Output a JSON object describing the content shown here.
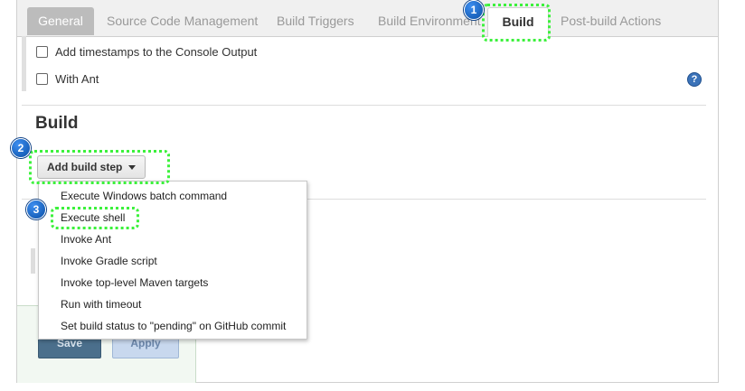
{
  "tabs": [
    "General",
    "Source Code Management",
    "Build Triggers",
    "Build Environment",
    "Build",
    "Post-build Actions"
  ],
  "active_tab": "Build",
  "build_environment": {
    "options": [
      {
        "label": "Add timestamps to the Console Output",
        "checked": false
      },
      {
        "label": "With Ant",
        "checked": false
      }
    ],
    "help_label": "?"
  },
  "build": {
    "heading": "Build",
    "add_step_label": "Add build step"
  },
  "menu": {
    "items": [
      "Execute Windows batch command",
      "Execute shell",
      "Invoke Ant",
      "Invoke Gradle script",
      "Invoke top-level Maven targets",
      "Run with timeout",
      "Set build status to \"pending\" on GitHub commit"
    ]
  },
  "buttons": {
    "save": "Save",
    "apply": "Apply"
  },
  "badges": [
    "1",
    "2",
    "3"
  ],
  "colors": {
    "highlight": "#3cf13c",
    "badge": "#0a4fa6",
    "active_tab_general": "#bcbcbc"
  }
}
